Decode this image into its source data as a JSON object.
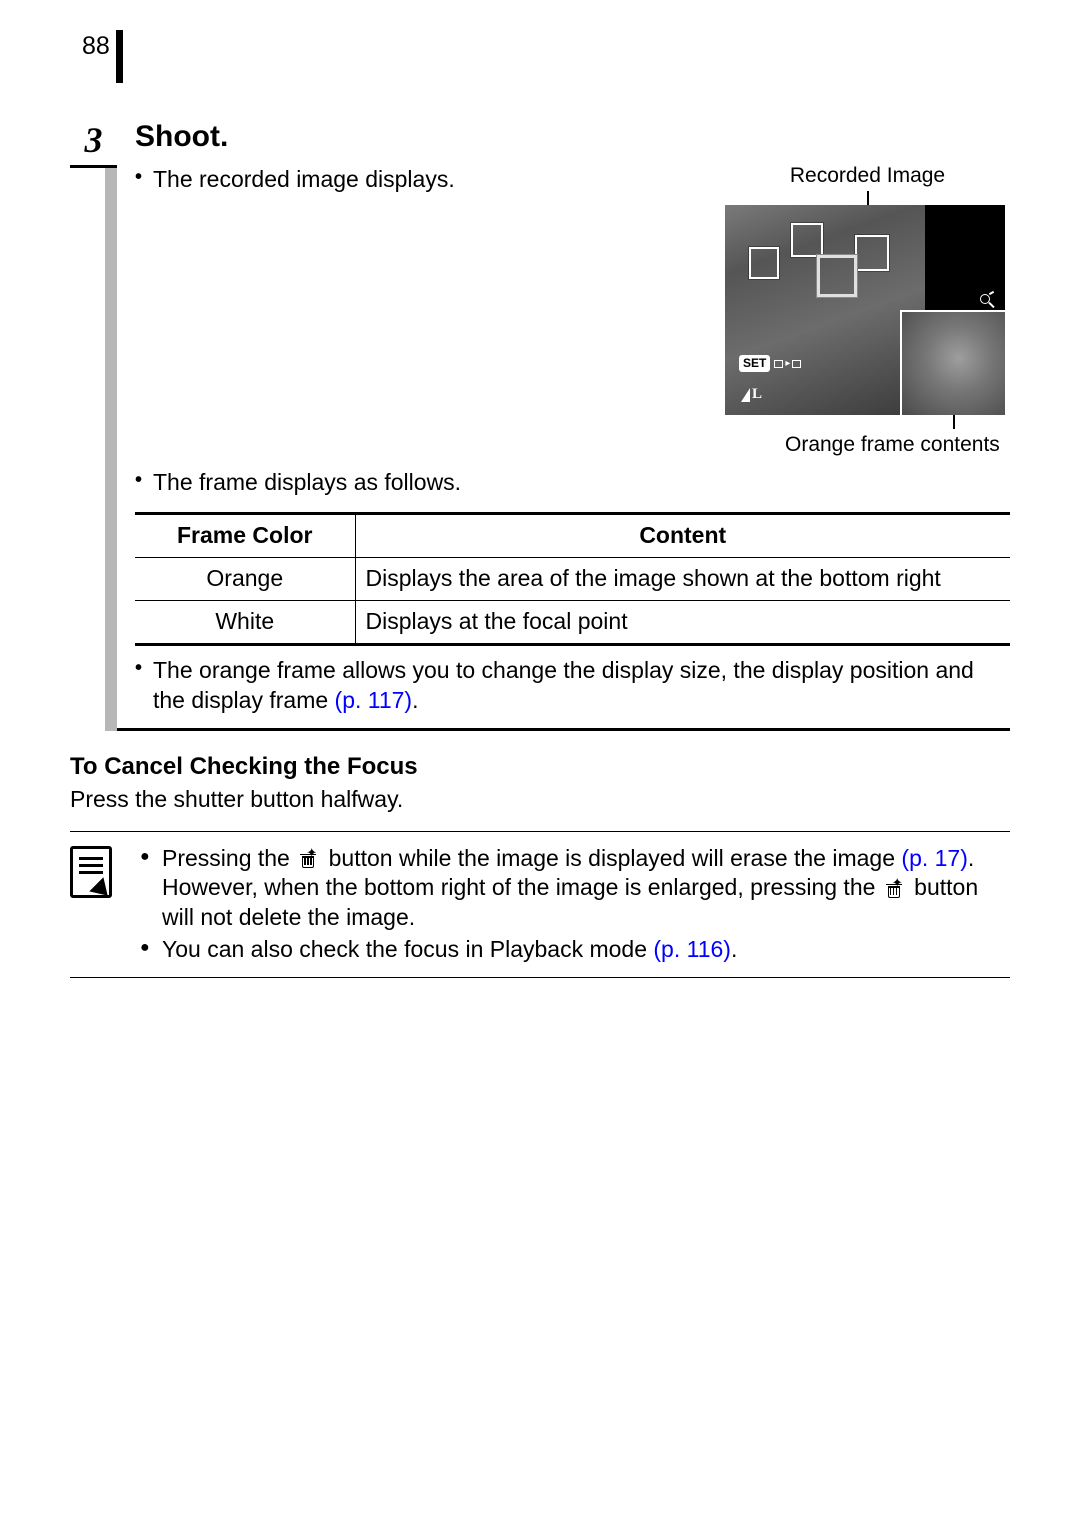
{
  "page_number": "88",
  "step_number": "3",
  "step_title": "Shoot.",
  "bullet1": "The recorded image displays.",
  "callout_top": "Recorded Image",
  "callout_bottom": "Orange frame contents",
  "preview_set_label": "SET",
  "bullet2": "The frame displays as follows.",
  "table": {
    "head_color": "Frame Color",
    "head_content": "Content",
    "row1_color": "Orange",
    "row1_content": "Displays the area of the image shown at the bottom right",
    "row2_color": "White",
    "row2_content": "Displays at the focal point"
  },
  "bullet3_a": "The orange frame allows you to change the display size, the display position and the display frame ",
  "bullet3_link": "(p. 117)",
  "bullet3_b": ".",
  "cancel_heading": "To Cancel Checking the Focus",
  "cancel_body": "Press the shutter button halfway.",
  "note1_a": "Pressing the ",
  "note1_b": " button while the image is displayed will erase the image ",
  "note1_link1": "(p. 17)",
  "note1_c": ". However, when the bottom right of the image is enlarged, pressing the ",
  "note1_d": " button will not delete the image.",
  "note2_a": "You can also check the focus in Playback mode ",
  "note2_link": "(p. 116)",
  "note2_b": "."
}
